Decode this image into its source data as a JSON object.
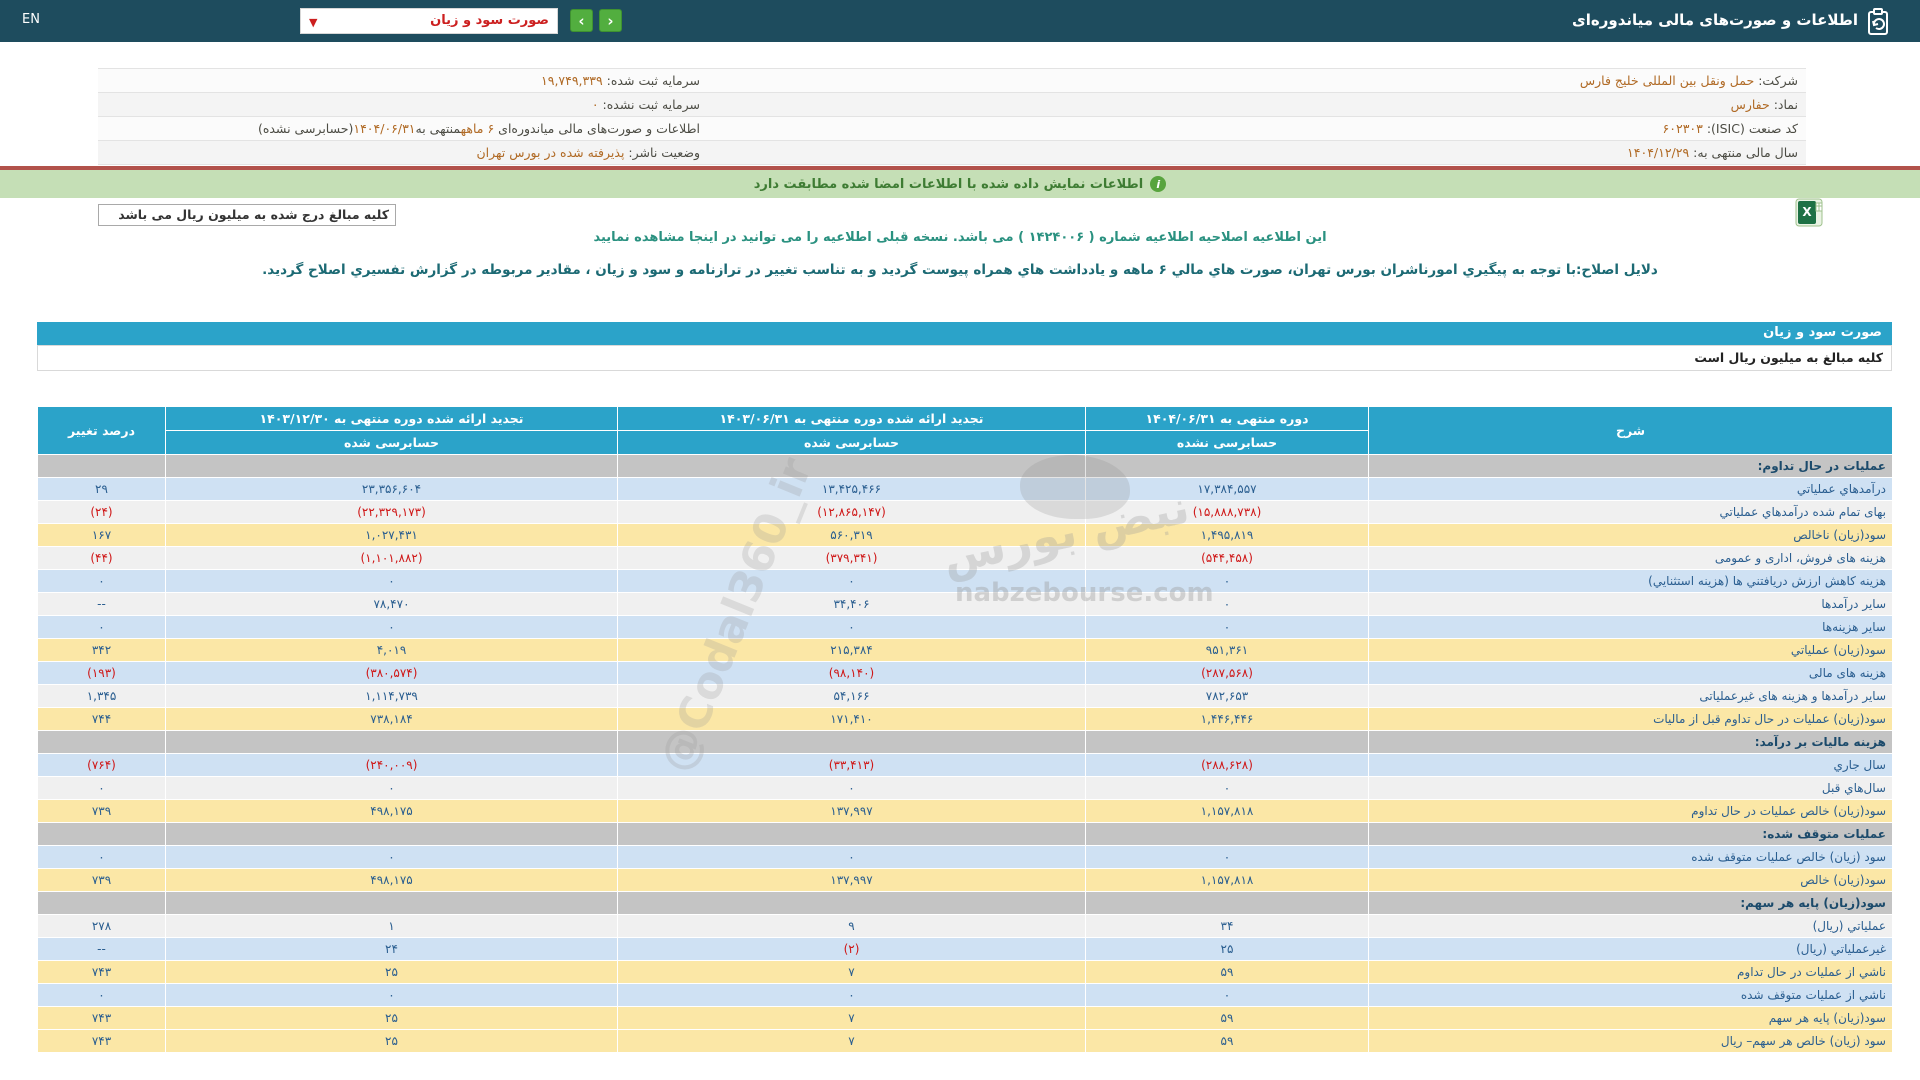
{
  "navbar": {
    "en_label": "EN",
    "title": "اطلاعات و صورت‌های مالی میاندوره‌ای",
    "dropdown_value": "صورت سود و زیان",
    "dropdown_caret": "▼",
    "prev_label": "‹",
    "next_label": "›"
  },
  "company": {
    "r1": {
      "rlabel": "شرکت:",
      "rvalue": "حمل ونقل بین المللی خلیج فارس",
      "llabel": "سرمایه ثبت شده:",
      "lvalue": "۱۹,۷۴۹,۳۳۹"
    },
    "r2": {
      "rlabel": "نماد:",
      "rvalue": "حفارس",
      "llabel": "سرمایه ثبت نشده:",
      "lvalue": "۰"
    },
    "r3": {
      "rlabel": "کد صنعت (ISIC):",
      "rvalue": "۶۰۲۳۰۳",
      "llabel": "اطلاعات و صورت‌های مالی میاندوره‌ای ",
      "lv_a1": "۶ ماهه",
      "lv_m": "منتهی به",
      "lv_a2": "۱۴۰۴/۰۶/۳۱",
      "lv_p": "(حسابرسی نشده)"
    },
    "r4": {
      "rlabel": "سال مالی منتهی به:",
      "rvalue": "۱۴۰۴/۱۲/۲۹",
      "llabel": "وضعیت ناشر:",
      "lvalue": "پذیرفته شده در بورس تهران"
    }
  },
  "banner": {
    "text": "اطلاعات نمایش داده شده با اطلاعات امضا شده مطابقت دارد",
    "icon": "i"
  },
  "units_box": "کلیه مبالغ درج شده به میلیون ریال می باشد",
  "notice1": "این اطلاعیه اصلاحیه اطلاعیه شماره ( ۱۴۲۴۰۰۶ ) می باشد. نسخه قبلی اطلاعیه را می توانید در اینجا مشاهده نمایید",
  "notice2": "دلایل اصلاح:با توجه به پیگیري امورناشران بورس تهران، صورت هاي مالي ۶ ماهه و یادداشت هاي همراه پیوست گردید و به تناسب تغییر در ترازنامه و سود و زیان ، مقادیر مربوطه در گزارش تفسیري اصلاح گردید.",
  "section_bar": "صورت سود و زیان",
  "units_row": "کلیه مبالغ به میلیون ریال است",
  "watermark": {
    "brand": "نبض بورس",
    "site": "nabzebourse.com",
    "handle": "@Codal360_ir"
  },
  "table": {
    "headers": {
      "desc": "شرح",
      "c1_top": "دوره منتهی به ۱۴۰۴/۰۶/۳۱",
      "c1_bottom": "حسابرسی نشده",
      "c2_top": "تجدید ارائه شده دوره منتهی به ۱۴۰۳/۰۶/۳۱",
      "c2_bottom": "حسابرسی شده",
      "c3_top": "تجدید ارائه شده دوره منتهی به ۱۴۰۳/۱۲/۳۰",
      "c3_bottom": "حسابرسی شده",
      "pct": "درصد تغییر"
    },
    "rows": [
      {
        "type": "section",
        "label": "عملیات در حال تداوم:"
      },
      {
        "type": "data",
        "style": "blue",
        "label": "درآمدهاي عملیاتي",
        "v1": "۱۷,۳۸۴,۵۵۷",
        "v2": "۱۳,۴۲۵,۴۶۶",
        "v3": "۲۳,۳۵۶,۶۰۴",
        "pct": "۲۹"
      },
      {
        "type": "data",
        "style": "white",
        "label": "بهای تمام شده درآمدهاي عملیاتي",
        "v1": "(۱۵,۸۸۸,۷۳۸)",
        "v2": "(۱۲,۸۶۵,۱۴۷)",
        "v3": "(۲۲,۳۲۹,۱۷۳)",
        "pct": "(۲۴)"
      },
      {
        "type": "data",
        "style": "yellow",
        "label": "سود(زیان) ناخالص",
        "v1": "۱,۴۹۵,۸۱۹",
        "v2": "۵۶۰,۳۱۹",
        "v3": "۱,۰۲۷,۴۳۱",
        "pct": "۱۶۷"
      },
      {
        "type": "data",
        "style": "white",
        "label": "هزینه های فروش، اداری و عمومی",
        "v1": "(۵۴۴,۴۵۸)",
        "v2": "(۳۷۹,۳۴۱)",
        "v3": "(۱,۱۰۱,۸۸۲)",
        "pct": "(۴۴)"
      },
      {
        "type": "data",
        "style": "blue",
        "label": "هزینه کاهش ارزش دریافتني ها (هزینه استثنایي)",
        "v1": "۰",
        "v2": "۰",
        "v3": "۰",
        "pct": "۰"
      },
      {
        "type": "data",
        "style": "white",
        "label": "سایر درآمدها",
        "v1": "۰",
        "v2": "۳۴,۴۰۶",
        "v3": "۷۸,۴۷۰",
        "pct": "--"
      },
      {
        "type": "data",
        "style": "blue",
        "label": "سایر هزینه‌ها",
        "v1": "۰",
        "v2": "۰",
        "v3": "۰",
        "pct": "۰"
      },
      {
        "type": "data",
        "style": "yellow",
        "label": "سود(زیان) عملیاتي",
        "v1": "۹۵۱,۳۶۱",
        "v2": "۲۱۵,۳۸۴",
        "v3": "۴,۰۱۹",
        "pct": "۳۴۲"
      },
      {
        "type": "data",
        "style": "blue",
        "label": "هزینه های مالی",
        "v1": "(۲۸۷,۵۶۸)",
        "v2": "(۹۸,۱۴۰)",
        "v3": "(۳۸۰,۵۷۴)",
        "pct": "(۱۹۳)"
      },
      {
        "type": "data",
        "style": "white",
        "label": "سایر درآمدها و هزینه های غیرعملیاتی",
        "v1": "۷۸۲,۶۵۳",
        "v2": "۵۴,۱۶۶",
        "v3": "۱,۱۱۴,۷۳۹",
        "pct": "۱,۳۴۵"
      },
      {
        "type": "data",
        "style": "yellow",
        "label": "سود(زیان) عملیات در حال تداوم قبل از مالیات",
        "v1": "۱,۴۴۶,۴۴۶",
        "v2": "۱۷۱,۴۱۰",
        "v3": "۷۳۸,۱۸۴",
        "pct": "۷۴۴"
      },
      {
        "type": "section",
        "label": "هزینه مالیات بر درآمد:"
      },
      {
        "type": "data",
        "style": "blue",
        "label": "سال جاري",
        "v1": "(۲۸۸,۶۲۸)",
        "v2": "(۳۳,۴۱۳)",
        "v3": "(۲۴۰,۰۰۹)",
        "pct": "(۷۶۴)"
      },
      {
        "type": "data",
        "style": "white",
        "label": "سال‌هاي قبل",
        "v1": "۰",
        "v2": "۰",
        "v3": "۰",
        "pct": "۰"
      },
      {
        "type": "data",
        "style": "yellow",
        "label": "سود(زیان) خالص عملیات در حال تداوم",
        "v1": "۱,۱۵۷,۸۱۸",
        "v2": "۱۳۷,۹۹۷",
        "v3": "۴۹۸,۱۷۵",
        "pct": "۷۳۹"
      },
      {
        "type": "section",
        "label": "عملیات متوقف شده:"
      },
      {
        "type": "data",
        "style": "blue",
        "label": "سود (زیان) خالص عملیات متوقف شده",
        "v1": "۰",
        "v2": "۰",
        "v3": "۰",
        "pct": "۰"
      },
      {
        "type": "data",
        "style": "yellow",
        "label": "سود(زیان) خالص",
        "v1": "۱,۱۵۷,۸۱۸",
        "v2": "۱۳۷,۹۹۷",
        "v3": "۴۹۸,۱۷۵",
        "pct": "۷۳۹"
      },
      {
        "type": "section",
        "label": "سود(زیان) پایه هر سهم:"
      },
      {
        "type": "data",
        "style": "white",
        "label": "عملیاتي (ریال)",
        "v1": "۳۴",
        "v2": "۹",
        "v3": "۱",
        "pct": "۲۷۸"
      },
      {
        "type": "data",
        "style": "blue",
        "label": "غیرعملیاتي (ریال)",
        "v1": "۲۵",
        "v2": "(۲)",
        "v3": "۲۴",
        "pct": "--"
      },
      {
        "type": "data",
        "style": "yellow",
        "label": "ناشي از عملیات در حال تداوم",
        "v1": "۵۹",
        "v2": "۷",
        "v3": "۲۵",
        "pct": "۷۴۳"
      },
      {
        "type": "data",
        "style": "blue",
        "label": "ناشي از عملیات متوقف شده",
        "v1": "۰",
        "v2": "۰",
        "v3": "۰",
        "pct": "۰"
      },
      {
        "type": "data",
        "style": "yellow",
        "label": "سود(زیان) پایه هر سهم",
        "v1": "۵۹",
        "v2": "۷",
        "v3": "۲۵",
        "pct": "۷۴۳"
      },
      {
        "type": "data",
        "style": "yellow",
        "label": "سود (زیان) خالص هر سهم– ریال",
        "v1": "۵۹",
        "v2": "۷",
        "v3": "۲۵",
        "pct": "۷۴۳"
      }
    ]
  }
}
